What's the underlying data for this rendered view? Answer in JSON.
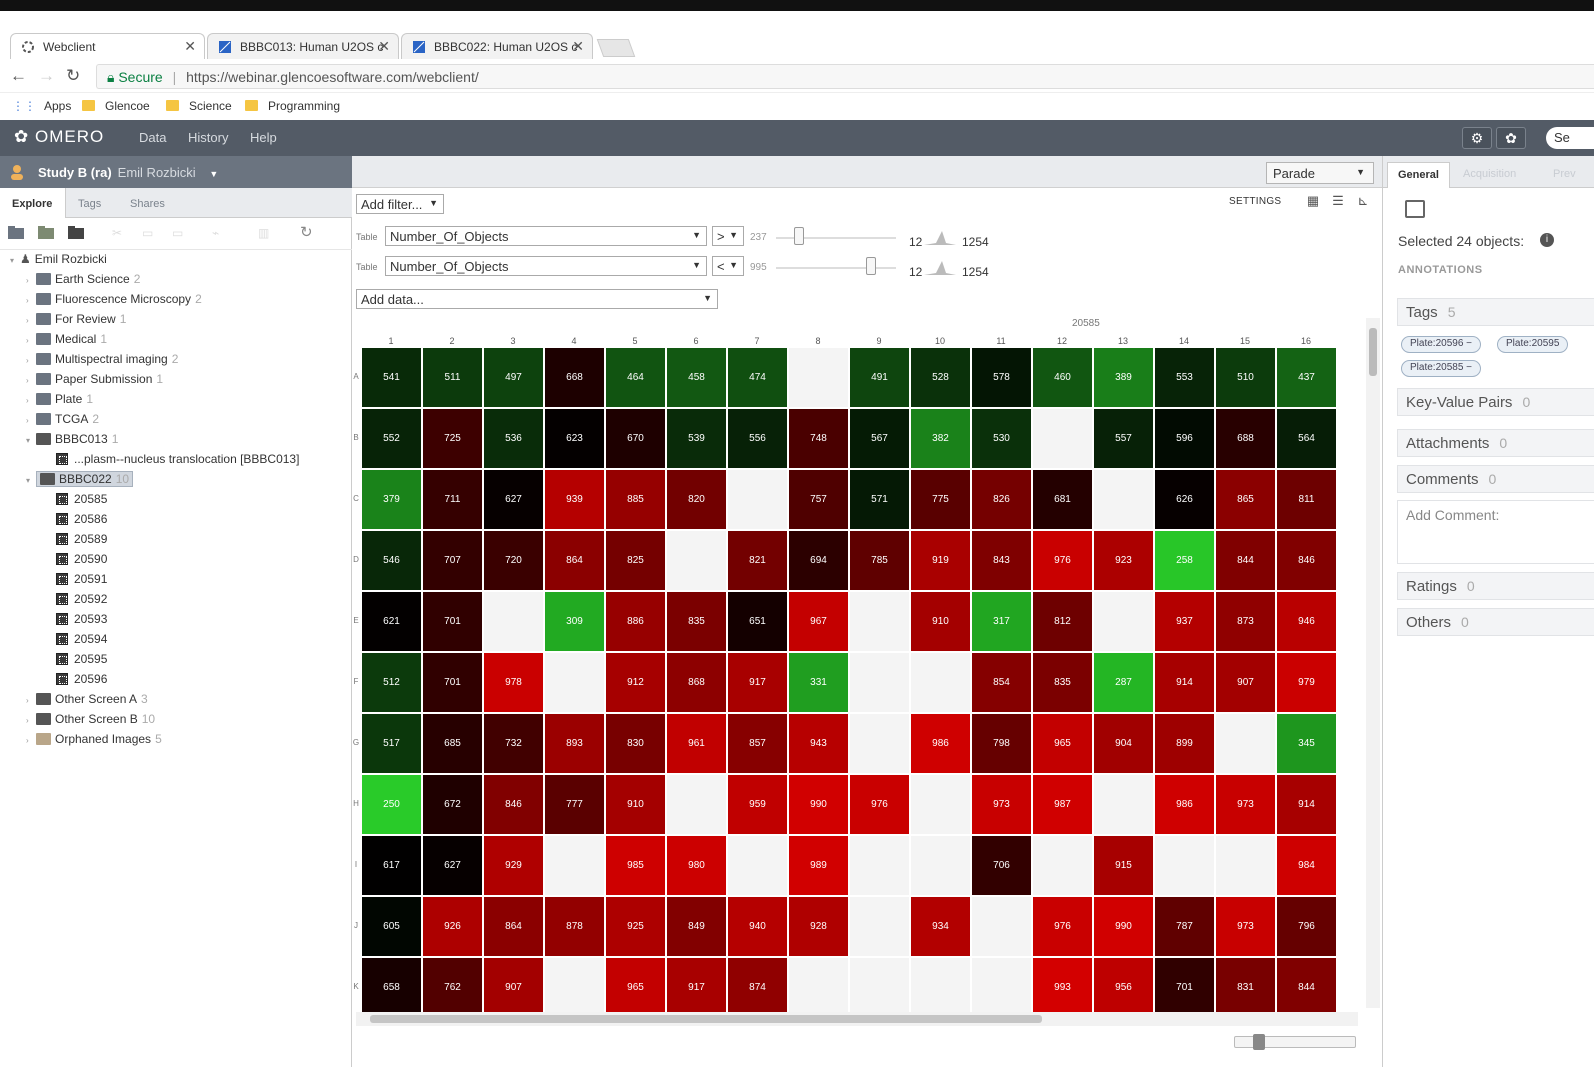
{
  "browser": {
    "tabs": [
      {
        "label": "Webclient",
        "active": true
      },
      {
        "label": "BBBC013: Human U2OS c",
        "active": false
      },
      {
        "label": "BBBC022: Human U2OS c",
        "active": false
      }
    ],
    "secure_label": "Secure",
    "url": "https://webinar.glencoesoftware.com/webclient/",
    "bookmarks": [
      "Apps",
      "Glencoe",
      "Science",
      "Programming"
    ]
  },
  "app": {
    "logo": "OMERO",
    "menu": [
      "Data",
      "History",
      "Help"
    ],
    "search_label": "Se"
  },
  "left": {
    "group": "Study B (ra)",
    "owner": "Emil Rozbicki",
    "tabs": [
      "Explore",
      "Tags",
      "Shares"
    ],
    "tree_root": "Emil Rozbicki",
    "projects": [
      {
        "name": "Earth Science",
        "count": "2"
      },
      {
        "name": "Fluorescence Microscopy",
        "count": "2"
      },
      {
        "name": "For Review",
        "count": "1"
      },
      {
        "name": "Medical",
        "count": "1"
      },
      {
        "name": "Multispectral imaging",
        "count": "2"
      },
      {
        "name": "Paper Submission",
        "count": "1"
      },
      {
        "name": "Plate",
        "count": "1"
      },
      {
        "name": "TCGA",
        "count": "2"
      }
    ],
    "bbbc013": {
      "name": "BBBC013",
      "count": "1",
      "child": "...plasm--nucleus translocation [BBBC013]"
    },
    "bbbc022": {
      "name": "BBBC022",
      "count": "10",
      "plates": [
        "20585",
        "20586",
        "20589",
        "20590",
        "20591",
        "20592",
        "20593",
        "20594",
        "20595",
        "20596"
      ]
    },
    "screens": [
      {
        "name": "Other Screen A",
        "count": "3"
      },
      {
        "name": "Other Screen B",
        "count": "10"
      }
    ],
    "orphaned": {
      "name": "Orphaned Images",
      "count": "5"
    }
  },
  "center": {
    "layout_select": "Parade",
    "add_filter": "Add filter...",
    "settings_label": "SETTINGS",
    "filters": [
      {
        "source": "Table",
        "column": "Number_Of_Objects",
        "op": ">",
        "value": "237",
        "min": "12",
        "max": "1254"
      },
      {
        "source": "Table",
        "column": "Number_Of_Objects",
        "op": "<",
        "value": "995",
        "min": "12",
        "max": "1254"
      }
    ],
    "add_data": "Add data...",
    "plate_name": "20585",
    "columns": [
      "1",
      "2",
      "3",
      "4",
      "5",
      "6",
      "7",
      "8",
      "9",
      "10",
      "11",
      "12",
      "13",
      "14",
      "15",
      "16"
    ],
    "rows": [
      "A",
      "B",
      "C",
      "D",
      "E",
      "F",
      "G",
      "H",
      "I",
      "J",
      "K"
    ],
    "wells": [
      [
        "541",
        "511",
        "497",
        "668",
        "464",
        "458",
        "474",
        "",
        "491",
        "528",
        "578",
        "460",
        "389",
        "553",
        "510",
        "437"
      ],
      [
        "552",
        "725",
        "536",
        "623",
        "670",
        "539",
        "556",
        "748",
        "567",
        "382",
        "530",
        "",
        "557",
        "596",
        "688",
        "564"
      ],
      [
        "379",
        "711",
        "627",
        "939",
        "885",
        "820",
        "",
        "757",
        "571",
        "775",
        "826",
        "681",
        "",
        "626",
        "865",
        "811"
      ],
      [
        "546",
        "707",
        "720",
        "864",
        "825",
        "",
        "821",
        "694",
        "785",
        "919",
        "843",
        "976",
        "923",
        "258",
        "844",
        "846"
      ],
      [
        "621",
        "701",
        "",
        "309",
        "886",
        "835",
        "651",
        "967",
        "",
        "910",
        "317",
        "812",
        "",
        "937",
        "873",
        "946"
      ],
      [
        "512",
        "701",
        "978",
        "",
        "912",
        "868",
        "917",
        "331",
        "",
        "",
        "854",
        "835",
        "287",
        "914",
        "907",
        "979"
      ],
      [
        "517",
        "685",
        "732",
        "893",
        "830",
        "961",
        "857",
        "943",
        "",
        "986",
        "798",
        "965",
        "904",
        "899",
        "",
        "345"
      ],
      [
        "250",
        "672",
        "846",
        "777",
        "910",
        "",
        "959",
        "990",
        "976",
        "",
        "973",
        "987",
        "",
        "986",
        "973",
        "914"
      ],
      [
        "617",
        "627",
        "929",
        "",
        "985",
        "980",
        "",
        "989",
        "",
        "",
        "706",
        "",
        "915",
        "",
        "",
        "984"
      ],
      [
        "605",
        "926",
        "864",
        "878",
        "925",
        "849",
        "940",
        "928",
        "",
        "934",
        "",
        "976",
        "990",
        "787",
        "973",
        "796"
      ],
      [
        "658",
        "762",
        "907",
        "",
        "965",
        "917",
        "874",
        "",
        "",
        "",
        "",
        "993",
        "956",
        "701",
        "831",
        "844"
      ]
    ],
    "color_scale": {
      "min": 237,
      "max": 995,
      "low_color": "#2ad22a",
      "high_color": "#d40000",
      "empty_color": "#f4f4f4"
    }
  },
  "right": {
    "tabs": [
      "General",
      "Acquisition",
      "Prev"
    ],
    "selected_text": "Selected 24 objects:",
    "annotations_header": "ANNOTATIONS",
    "tags_label": "Tags",
    "tags_count": "5",
    "tag_pills": [
      "Plate:20596",
      "Plate:20595",
      "Plate:20585"
    ],
    "kv_label": "Key-Value Pairs",
    "kv_count": "0",
    "attachments_label": "Attachments",
    "attachments_count": "0",
    "comments_label": "Comments",
    "comments_count": "0",
    "add_comment_placeholder": "Add Comment:",
    "ratings_label": "Ratings",
    "ratings_count": "0",
    "others_label": "Others",
    "others_count": "0"
  }
}
